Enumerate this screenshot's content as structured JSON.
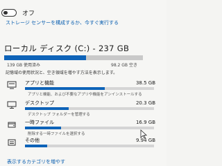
{
  "storage_sense": {
    "toggle_state": "オフ",
    "configure_link": "ストレージ センサーを構成するか、今すぐ実行する"
  },
  "disk": {
    "title": "ローカル ディスク (C:) - 237 GB",
    "used_text": "139 GB 使用済み",
    "free_text": "98.2 GB 空き",
    "used_fraction": 0.59,
    "description": "記憶域の使用状況と、空き領域を増やす方法を表示します。"
  },
  "categories": [
    {
      "icon": "apps-icon",
      "name": "アプリと機能",
      "size": "38.5 GB",
      "fraction": 0.62,
      "sub": "アプリと機能、および不要なアプリや機能をアンインストールする"
    },
    {
      "icon": "desktop-icon",
      "name": "デスクトップ",
      "size": "20.3 GB",
      "fraction": 0.34,
      "sub": "デスクトップ フォルダーを管理する"
    },
    {
      "icon": "temp-files-icon",
      "name": "一時ファイル",
      "size": "16.9 GB",
      "fraction": 0.28,
      "sub": "削除する一時ファイルを選択する"
    },
    {
      "icon": "other-icon",
      "name": "その他",
      "size": "9.94 GB",
      "fraction": 0.17,
      "sub": ""
    }
  ],
  "footer": {
    "more_link": "表示するカテゴリを増やす"
  },
  "colors": {
    "accent": "#0e63b8",
    "link": "#0a5fb0",
    "bar_track": "#d5d5d5"
  }
}
